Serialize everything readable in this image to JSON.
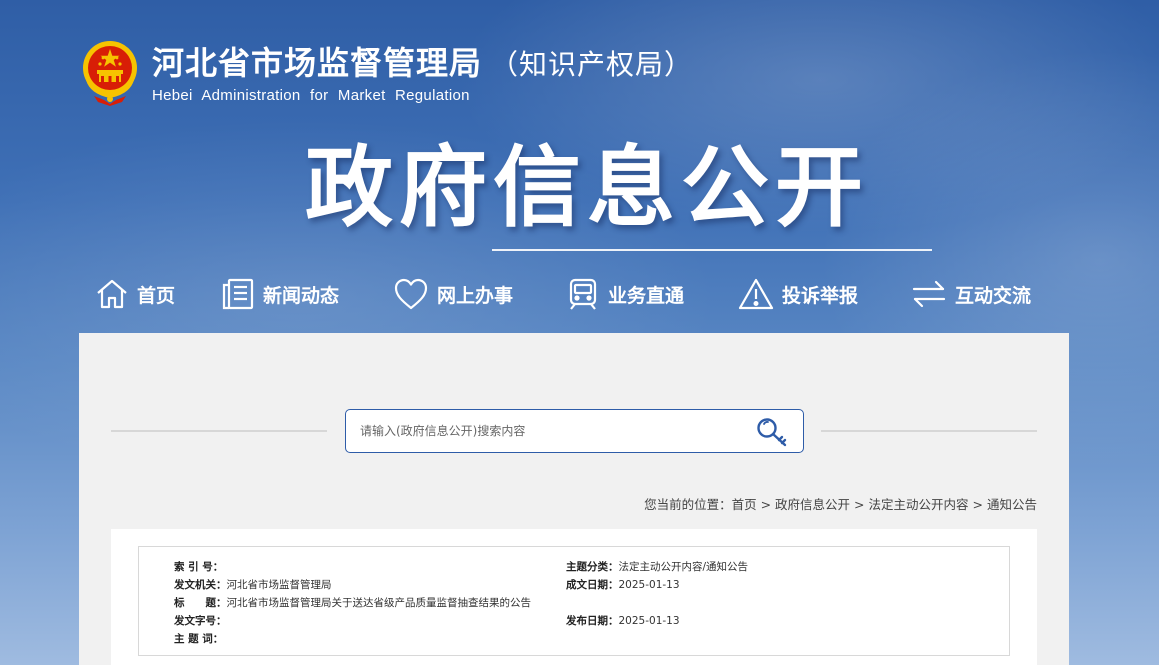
{
  "header": {
    "cn_title": "河北省市场监督管理局",
    "cn_subtitle": "（知识产权局）",
    "en_title": "Hebei Administration for Market Regulation"
  },
  "banner": {
    "title": "政府信息公开"
  },
  "nav": [
    {
      "label": "首页",
      "icon": "home-icon"
    },
    {
      "label": "新闻动态",
      "icon": "news-icon"
    },
    {
      "label": "网上办事",
      "icon": "heart-icon"
    },
    {
      "label": "业务直通",
      "icon": "train-icon"
    },
    {
      "label": "投诉举报",
      "icon": "warning-icon"
    },
    {
      "label": "互动交流",
      "icon": "exchange-icon"
    }
  ],
  "search": {
    "placeholder": "请输入(政府信息公开)搜索内容",
    "icon": "search-icon"
  },
  "breadcrumb": {
    "prefix": "您当前的位置：",
    "items": [
      "首页",
      "政府信息公开",
      "法定主动公开内容",
      "通知公告"
    ],
    "separator": ">"
  },
  "info": {
    "index_label": "索 引 号：",
    "index_value": "",
    "issuer_label": "发文机关：",
    "issuer_value": "河北省市场监督管理局",
    "title_label": "标　　题：",
    "title_value": "河北省市场监督管理局关于送达省级产品质量监督抽查结果的公告",
    "docno_label": "发文字号：",
    "docno_value": "",
    "keywords_label": "主 题 词：",
    "keywords_value": "",
    "category_label": "主题分类：",
    "category_value": "法定主动公开内容/通知公告",
    "created_label": "成文日期：",
    "created_value": "2025-01-13",
    "published_label": "发布日期：",
    "published_value": "2025-01-13"
  },
  "colors": {
    "primary_blue": "#2e5ca8",
    "emblem_red": "#d81e06",
    "emblem_gold": "#f7c300"
  }
}
